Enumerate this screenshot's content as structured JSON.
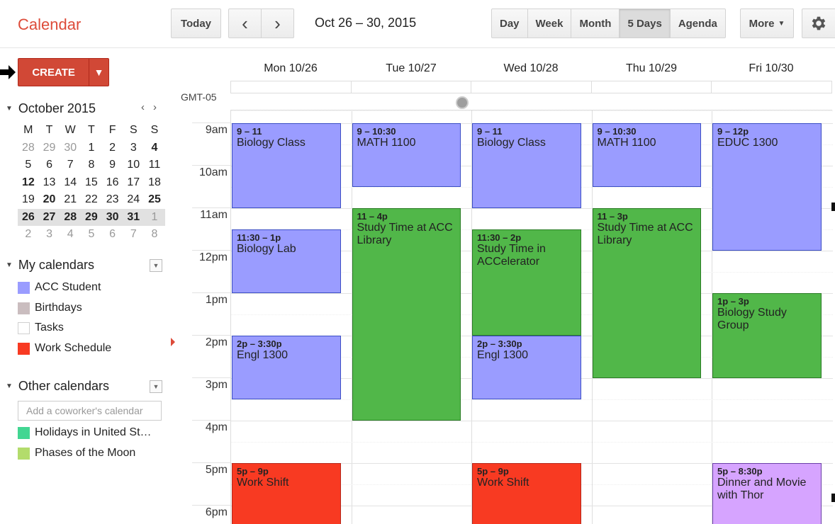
{
  "header": {
    "app_title": "Calendar",
    "today_label": "Today",
    "date_range": "Oct 26 – 30, 2015",
    "views": [
      {
        "label": "Day",
        "active": false
      },
      {
        "label": "Week",
        "active": false
      },
      {
        "label": "Month",
        "active": false
      },
      {
        "label": "5 Days",
        "active": true
      },
      {
        "label": "Agenda",
        "active": false
      }
    ],
    "more_label": "More",
    "icons": {
      "prev": "chevron-left-icon",
      "next": "chevron-right-icon",
      "settings": "gear-icon",
      "more": "caret-down-icon"
    }
  },
  "sidebar": {
    "create_label": "CREATE",
    "mini_calendar": {
      "month_label": "October 2015",
      "weekdays": [
        "M",
        "T",
        "W",
        "T",
        "F",
        "S",
        "S"
      ],
      "weeks": [
        [
          "28",
          "29",
          "30",
          "1",
          "2",
          "3",
          "4"
        ],
        [
          "5",
          "6",
          "7",
          "8",
          "9",
          "10",
          "11"
        ],
        [
          "12",
          "13",
          "14",
          "15",
          "16",
          "17",
          "18"
        ],
        [
          "19",
          "20",
          "21",
          "22",
          "23",
          "24",
          "25"
        ],
        [
          "26",
          "27",
          "28",
          "29",
          "30",
          "31",
          "1"
        ],
        [
          "2",
          "3",
          "4",
          "5",
          "6",
          "7",
          "8"
        ]
      ]
    },
    "my_calendars": {
      "label": "My calendars",
      "items": [
        {
          "label": "ACC Student",
          "color": "#9a9cff",
          "border": "#9a9cff"
        },
        {
          "label": "Birthdays",
          "color": "#cabdbf",
          "border": "#cabdbf"
        },
        {
          "label": "Tasks",
          "color": "#ffffff",
          "border": "#d0d0d0"
        },
        {
          "label": "Work Schedule",
          "color": "#f83a22",
          "border": "#f83a22"
        }
      ]
    },
    "other_calendars": {
      "label": "Other calendars",
      "add_placeholder": "Add a coworker's calendar",
      "items": [
        {
          "label": "Holidays in United St…",
          "color": "#42d692",
          "border": "#42d692"
        },
        {
          "label": "Phases of the Moon",
          "color": "#b3dc6c",
          "border": "#b3dc6c"
        }
      ]
    }
  },
  "grid": {
    "timezone_label": "GMT-05",
    "days": [
      "Mon 10/26",
      "Tue 10/27",
      "Wed 10/28",
      "Thu 10/29",
      "Fri 10/30"
    ],
    "hours": [
      "9am",
      "10am",
      "11am",
      "12pm",
      "1pm",
      "2pm",
      "3pm",
      "4pm",
      "5pm",
      "6pm"
    ],
    "events": [
      {
        "day": 0,
        "start": 9,
        "end": 11,
        "time": "9 – 11",
        "title": "Biology Class",
        "color": "blue"
      },
      {
        "day": 0,
        "start": 11.5,
        "end": 13,
        "time": "11:30 – 1p",
        "title": "Biology Lab",
        "color": "blue"
      },
      {
        "day": 0,
        "start": 14,
        "end": 15.5,
        "time": "2p – 3:30p",
        "title": "Engl 1300",
        "color": "blue"
      },
      {
        "day": 0,
        "start": 17,
        "end": 21,
        "time": "5p – 9p",
        "title": "Work Shift",
        "color": "red"
      },
      {
        "day": 1,
        "start": 9,
        "end": 10.5,
        "time": "9 – 10:30",
        "title": "MATH 1100",
        "color": "blue"
      },
      {
        "day": 1,
        "start": 11,
        "end": 16,
        "time": "11 – 4p",
        "title": "Study Time at ACC Library",
        "color": "green"
      },
      {
        "day": 2,
        "start": 9,
        "end": 11,
        "time": "9 – 11",
        "title": "Biology Class",
        "color": "blue"
      },
      {
        "day": 2,
        "start": 11.5,
        "end": 14,
        "time": "11:30 – 2p",
        "title": "Study Time in ACCelerator",
        "color": "green"
      },
      {
        "day": 2,
        "start": 14,
        "end": 15.5,
        "time": "2p – 3:30p",
        "title": "Engl 1300",
        "color": "blue"
      },
      {
        "day": 2,
        "start": 17,
        "end": 21,
        "time": "5p – 9p",
        "title": "Work Shift",
        "color": "red"
      },
      {
        "day": 3,
        "start": 9,
        "end": 10.5,
        "time": "9 – 10:30",
        "title": "MATH 1100",
        "color": "blue"
      },
      {
        "day": 3,
        "start": 11,
        "end": 15,
        "time": "11 – 3p",
        "title": "Study Time at ACC Library",
        "color": "green"
      },
      {
        "day": 4,
        "start": 9,
        "end": 12,
        "time": "9 – 12p",
        "title": "EDUC 1300",
        "color": "blue"
      },
      {
        "day": 4,
        "start": 13,
        "end": 15,
        "time": "1p – 3p",
        "title": "Biology Study Group",
        "color": "green"
      },
      {
        "day": 4,
        "start": 17,
        "end": 20.5,
        "time": "5p – 8:30p",
        "title": "Dinner and Movie with Thor",
        "color": "purple"
      }
    ]
  }
}
